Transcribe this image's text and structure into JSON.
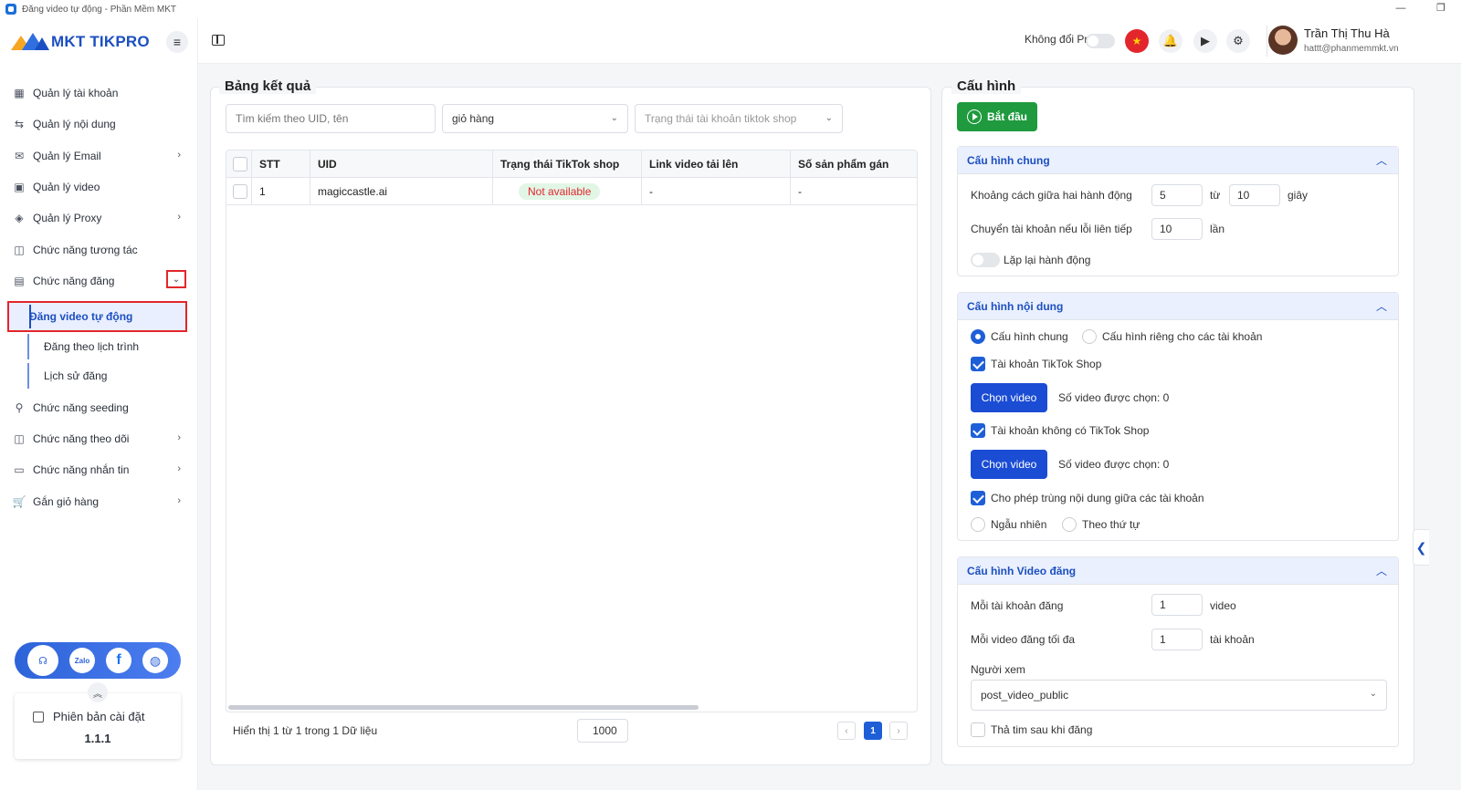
{
  "window": {
    "title": "Đăng video tự động - Phần Mềm MKT",
    "controls": [
      "—",
      "❐"
    ]
  },
  "brand": {
    "name": "MKT TIKPRO",
    "colors": {
      "primary": "#1c4fc0",
      "accent": "#f5a623",
      "green": "#1f9a3e",
      "red": "#e3262b"
    }
  },
  "sidebar": {
    "menu_icon": "≡",
    "items": [
      {
        "label": "Quản lý tài khoản",
        "icon": "grid-icon",
        "glyph": "▦",
        "chevron": ""
      },
      {
        "label": "Quản lý nội dung",
        "icon": "swap-icon",
        "glyph": "⇆",
        "chevron": ""
      },
      {
        "label": "Quản lý Email",
        "icon": "mail-icon",
        "glyph": "✉",
        "chevron": "›"
      },
      {
        "label": "Quản lý video",
        "icon": "video-icon",
        "glyph": "▣",
        "chevron": ""
      },
      {
        "label": "Quản lý Proxy",
        "icon": "layers-icon",
        "glyph": "◈",
        "chevron": "›"
      },
      {
        "label": "Chức năng tương tác",
        "icon": "interact-icon",
        "glyph": "◫",
        "chevron": ""
      },
      {
        "label": "Chức năng đăng",
        "icon": "post-icon",
        "glyph": "▤",
        "chevron": "⌄"
      },
      {
        "label": "Chức năng seeding",
        "icon": "seeding-icon",
        "glyph": "⚲",
        "chevron": ""
      },
      {
        "label": "Chức năng theo dõi",
        "icon": "follow-icon",
        "glyph": "◫",
        "chevron": "›"
      },
      {
        "label": "Chức năng nhắn tin",
        "icon": "chat-icon",
        "glyph": "▭",
        "chevron": "›"
      },
      {
        "label": "Gắn giỏ hàng",
        "icon": "cart-icon",
        "glyph": "🛒",
        "chevron": "›"
      }
    ],
    "sub_items": [
      {
        "label": "Đăng video tự động",
        "active": true
      },
      {
        "label": "Đăng theo lịch trình",
        "active": false
      },
      {
        "label": "Lịch sử đăng",
        "active": false
      }
    ],
    "support": {
      "headset": "☊",
      "zalo": "Zalo",
      "facebook": "f",
      "web": "◍",
      "collapse": "︽"
    },
    "version": {
      "label": "Phiên bản cài đặt",
      "number": "1.1.1"
    }
  },
  "header": {
    "proxy_label": "Không đổi Proxy",
    "flag": "★",
    "bell": "🔔",
    "play": "▶",
    "gear": "⚙",
    "user": {
      "name": "Trần Thị Thu Hà",
      "email": "hattt@phanmemmkt.vn"
    }
  },
  "results": {
    "title": "Bảng kết quả",
    "search_placeholder": "Tìm kiếm theo UID, tên",
    "filter1": "giỏ hàng",
    "filter2_placeholder": "Trạng thái tài khoản tiktok shop",
    "dropdown_glyph": "⌄",
    "columns": [
      "STT",
      "UID",
      "Trạng thái TikTok shop",
      "Link video tải lên",
      "Số sản phẩm gán"
    ],
    "rows": [
      {
        "stt": "1",
        "uid": "magiccastle.ai",
        "status": "Not available",
        "link": "-",
        "products": "-"
      }
    ],
    "footer_text": "Hiển thị 1 từ 1 trong 1 Dữ liệu",
    "page_size": "1000",
    "prev": "‹",
    "next": "›",
    "page": "1"
  },
  "config": {
    "title": "Cấu hình",
    "start_label": "Bắt đầu",
    "collapse_glyph": "︿",
    "general": {
      "title": "Cấu hình chung",
      "delay_label": "Khoảng cách giữa hai hành động",
      "delay_from": "5",
      "to_label": "từ",
      "delay_to": "10",
      "unit_seconds": "giây",
      "switch_label": "Chuyển tài khoản nếu lỗi liên tiếp",
      "switch_value": "10",
      "unit_times": "lần",
      "repeat_label": "Lặp lại hành động"
    },
    "content": {
      "title": "Cấu hình nội dung",
      "radio_general": "Cấu hình chung",
      "radio_private": "Cấu hình riêng cho các tài khoản",
      "tiktok_shop_label": "Tài khoản TikTok Shop",
      "choose_video": "Chọn video",
      "selected_count_1": "Số video được chọn: 0",
      "no_shop_label": "Tài khoản không có TikTok Shop",
      "selected_count_2": "Số video được chọn: 0",
      "allow_dup_label": "Cho phép trùng nội dung giữa các tài khoản",
      "random_label": "Ngẫu nhiên",
      "order_label": "Theo thứ tự"
    },
    "video": {
      "title": "Cấu hình Video đăng",
      "per_account_label": "Mỗi tài khoản đăng",
      "per_account_value": "1",
      "unit_video": "video",
      "max_label": "Mỗi video đăng tối đa",
      "max_value": "1",
      "unit_account": "tài khoản",
      "viewer_label": "Người xem",
      "viewer_value": "post_video_public",
      "heart_label": "Thả tim sau khi đăng"
    },
    "side_tab": "❮"
  }
}
